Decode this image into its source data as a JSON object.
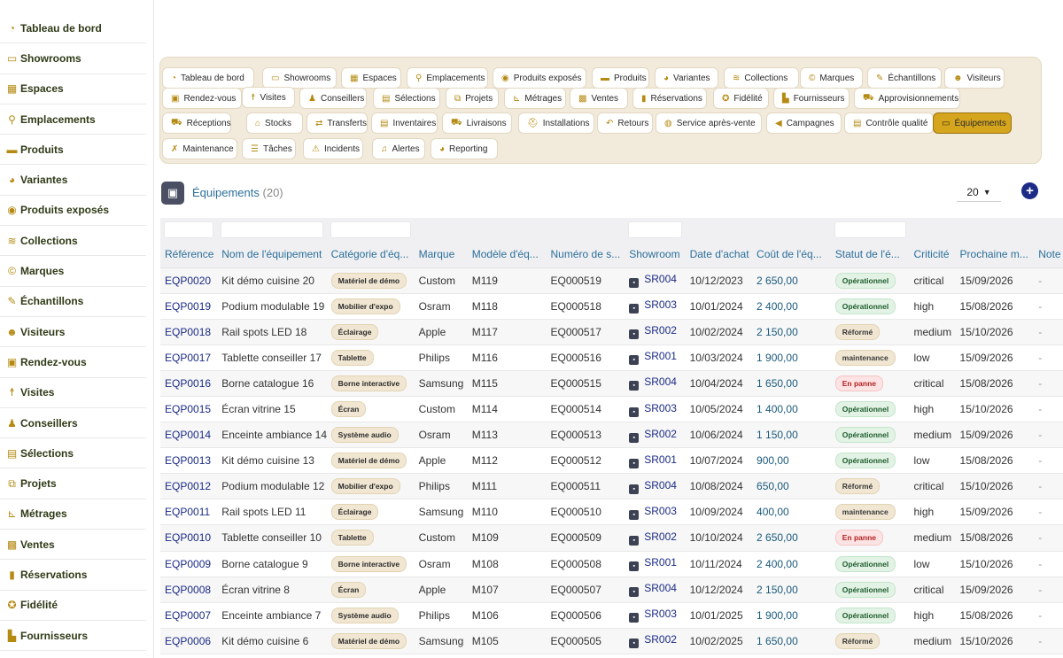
{
  "sidebar": {
    "items": [
      {
        "label": "Tableau de bord",
        "icon": "dashboard-icon",
        "glyph": "◔"
      },
      {
        "label": "Showrooms",
        "icon": "showroom-icon",
        "glyph": "▭"
      },
      {
        "label": "Espaces",
        "icon": "grid-icon",
        "glyph": "▦"
      },
      {
        "label": "Emplacements",
        "icon": "map-pin-icon",
        "glyph": "⚲"
      },
      {
        "label": "Produits",
        "icon": "box-icon",
        "glyph": "▬"
      },
      {
        "label": "Variantes",
        "icon": "palette-icon",
        "glyph": "◕"
      },
      {
        "label": "Produits exposés",
        "icon": "eye-icon",
        "glyph": "◉"
      },
      {
        "label": "Collections",
        "icon": "layers-icon",
        "glyph": "≋"
      },
      {
        "label": "Marques",
        "icon": "copyright-icon",
        "glyph": "©"
      },
      {
        "label": "Échantillons",
        "icon": "pen-icon",
        "glyph": "✎"
      },
      {
        "label": "Visiteurs",
        "icon": "users-icon",
        "glyph": "☻"
      },
      {
        "label": "Rendez-vous",
        "icon": "calendar-check-icon",
        "glyph": "▣"
      },
      {
        "label": "Visites",
        "icon": "walking-icon",
        "glyph": "☨"
      },
      {
        "label": "Conseillers",
        "icon": "user-tie-icon",
        "glyph": "♟"
      },
      {
        "label": "Sélections",
        "icon": "clipboard-icon",
        "glyph": "▤"
      },
      {
        "label": "Projets",
        "icon": "project-diagram-icon",
        "glyph": "⧉"
      },
      {
        "label": "Métrages",
        "icon": "ruler-icon",
        "glyph": "⊾"
      },
      {
        "label": "Ventes",
        "icon": "cash-register-icon",
        "glyph": "▩"
      },
      {
        "label": "Réservations",
        "icon": "bookmark-icon",
        "glyph": "▮"
      },
      {
        "label": "Fidélité",
        "icon": "award-icon",
        "glyph": "✪"
      },
      {
        "label": "Fournisseurs",
        "icon": "industry-icon",
        "glyph": "▙"
      }
    ]
  },
  "tabs": [
    {
      "label": "Tableau de bord",
      "icon": "dashboard-icon",
      "glyph": "◔"
    },
    {
      "label": "Showrooms",
      "icon": "showroom-icon",
      "glyph": "▭"
    },
    {
      "label": "Espaces",
      "icon": "grid-icon",
      "glyph": "▦"
    },
    {
      "label": "Emplacements",
      "icon": "map-pin-icon",
      "glyph": "⚲"
    },
    {
      "label": "Produits exposés",
      "icon": "eye-icon",
      "glyph": "◉"
    },
    {
      "label": "Produits",
      "icon": "box-icon",
      "glyph": "▬"
    },
    {
      "label": "Variantes",
      "icon": "palette-icon",
      "glyph": "◕"
    },
    {
      "label": "Collections",
      "icon": "layers-icon",
      "glyph": "≋"
    },
    {
      "label": "Marques",
      "icon": "copyright-icon",
      "glyph": "©"
    },
    {
      "label": "Échantillons",
      "icon": "pen-icon",
      "glyph": "✎"
    },
    {
      "label": "Visiteurs",
      "icon": "users-icon",
      "glyph": "☻"
    },
    {
      "label": "Rendez-vous",
      "icon": "calendar-check-icon",
      "glyph": "▣"
    },
    {
      "label": "Visites",
      "icon": "walking-icon",
      "glyph": "☨"
    },
    {
      "label": "Conseillers",
      "icon": "user-tie-icon",
      "glyph": "♟"
    },
    {
      "label": "Sélections",
      "icon": "clipboard-icon",
      "glyph": "▤"
    },
    {
      "label": "Projets",
      "icon": "project-diagram-icon",
      "glyph": "⧉"
    },
    {
      "label": "Métrages",
      "icon": "ruler-icon",
      "glyph": "⊾"
    },
    {
      "label": "Ventes",
      "icon": "cash-register-icon",
      "glyph": "▩"
    },
    {
      "label": "Réservations",
      "icon": "bookmark-icon",
      "glyph": "▮"
    },
    {
      "label": "Fidélité",
      "icon": "award-icon",
      "glyph": "✪"
    },
    {
      "label": "Fournisseurs",
      "icon": "industry-icon",
      "glyph": "▙"
    },
    {
      "label": "Approvisionnements",
      "icon": "dolly-icon",
      "glyph": "⛟"
    },
    {
      "label": "Réceptions",
      "icon": "truck-loading-icon",
      "glyph": "⛟"
    },
    {
      "label": "Stocks",
      "icon": "warehouse-icon",
      "glyph": "⌂"
    },
    {
      "label": "Transferts",
      "icon": "exchange-icon",
      "glyph": "⇄"
    },
    {
      "label": "Inventaires",
      "icon": "clipboard-check-icon",
      "glyph": "▤"
    },
    {
      "label": "Livraisons",
      "icon": "truck-icon",
      "glyph": "⛟"
    },
    {
      "label": "Installations",
      "icon": "hard-hat-icon",
      "glyph": "⛑"
    },
    {
      "label": "Retours",
      "icon": "undo-icon",
      "glyph": "↶"
    },
    {
      "label": "Service après-vente",
      "icon": "comment-icon",
      "glyph": "◍"
    },
    {
      "label": "Campagnes",
      "icon": "bullhorn-icon",
      "glyph": "◀"
    },
    {
      "label": "Contrôle qualité",
      "icon": "clipboard-list-icon",
      "glyph": "▤"
    },
    {
      "label": "Équipements",
      "icon": "laptop-icon",
      "glyph": "▭",
      "active": true
    },
    {
      "label": "Maintenance",
      "icon": "tools-icon",
      "glyph": "✗"
    },
    {
      "label": "Tâches",
      "icon": "tasks-icon",
      "glyph": "☰"
    },
    {
      "label": "Incidents",
      "icon": "warning-icon",
      "glyph": "⚠"
    },
    {
      "label": "Alertes",
      "icon": "bell-icon",
      "glyph": "♫"
    },
    {
      "label": "Reporting",
      "icon": "chart-pie-icon",
      "glyph": "◕"
    }
  ],
  "page": {
    "title": "Équipements",
    "count": "(20)",
    "page_size": "20",
    "add_label": "+"
  },
  "table": {
    "columns": [
      "Référence",
      "Nom de l'équipement",
      "Catégorie d'éq...",
      "Marque",
      "Modèle d'éq...",
      "Numéro de s...",
      "Showroom",
      "Date d'achat",
      "Coût de l'éq...",
      "Statut de l'é...",
      "Criticité",
      "Prochaine m...",
      "Note"
    ],
    "rows": [
      [
        "EQP0020",
        "Kit démo cuisine 20",
        "Matériel de démo",
        "Custom",
        "M119",
        "EQ000519",
        "SR004",
        "10/12/2023",
        "2 650,00",
        "Opérationnel",
        "critical",
        "15/09/2026",
        "-"
      ],
      [
        "EQP0019",
        "Podium modulable 19",
        "Mobilier d'expo",
        "Osram",
        "M118",
        "EQ000518",
        "SR003",
        "10/01/2024",
        "2 400,00",
        "Opérationnel",
        "high",
        "15/08/2026",
        "-"
      ],
      [
        "EQP0018",
        "Rail spots LED 18",
        "Éclairage",
        "Apple",
        "M117",
        "EQ000517",
        "SR002",
        "10/02/2024",
        "2 150,00",
        "Réformé",
        "medium",
        "15/10/2026",
        "-"
      ],
      [
        "EQP0017",
        "Tablette conseiller 17",
        "Tablette",
        "Philips",
        "M116",
        "EQ000516",
        "SR001",
        "10/03/2024",
        "1 900,00",
        "maintenance",
        "low",
        "15/09/2026",
        "-"
      ],
      [
        "EQP0016",
        "Borne catalogue 16",
        "Borne interactive",
        "Samsung",
        "M115",
        "EQ000515",
        "SR004",
        "10/04/2024",
        "1 650,00",
        "En panne",
        "critical",
        "15/08/2026",
        "-"
      ],
      [
        "EQP0015",
        "Écran vitrine 15",
        "Écran",
        "Custom",
        "M114",
        "EQ000514",
        "SR003",
        "10/05/2024",
        "1 400,00",
        "Opérationnel",
        "high",
        "15/10/2026",
        "-"
      ],
      [
        "EQP0014",
        "Enceinte ambiance 14",
        "Système audio",
        "Osram",
        "M113",
        "EQ000513",
        "SR002",
        "10/06/2024",
        "1 150,00",
        "Opérationnel",
        "medium",
        "15/09/2026",
        "-"
      ],
      [
        "EQP0013",
        "Kit démo cuisine 13",
        "Matériel de démo",
        "Apple",
        "M112",
        "EQ000512",
        "SR001",
        "10/07/2024",
        "900,00",
        "Opérationnel",
        "low",
        "15/08/2026",
        "-"
      ],
      [
        "EQP0012",
        "Podium modulable 12",
        "Mobilier d'expo",
        "Philips",
        "M111",
        "EQ000511",
        "SR004",
        "10/08/2024",
        "650,00",
        "Réformé",
        "critical",
        "15/10/2026",
        "-"
      ],
      [
        "EQP0011",
        "Rail spots LED 11",
        "Éclairage",
        "Samsung",
        "M110",
        "EQ000510",
        "SR003",
        "10/09/2024",
        "400,00",
        "maintenance",
        "high",
        "15/09/2026",
        "-"
      ],
      [
        "EQP0010",
        "Tablette conseiller 10",
        "Tablette",
        "Custom",
        "M109",
        "EQ000509",
        "SR002",
        "10/10/2024",
        "2 650,00",
        "En panne",
        "medium",
        "15/08/2026",
        "-"
      ],
      [
        "EQP0009",
        "Borne catalogue 9",
        "Borne interactive",
        "Osram",
        "M108",
        "EQ000508",
        "SR001",
        "10/11/2024",
        "2 400,00",
        "Opérationnel",
        "low",
        "15/10/2026",
        "-"
      ],
      [
        "EQP0008",
        "Écran vitrine 8",
        "Écran",
        "Apple",
        "M107",
        "EQ000507",
        "SR004",
        "10/12/2024",
        "2 150,00",
        "Opérationnel",
        "critical",
        "15/09/2026",
        "-"
      ],
      [
        "EQP0007",
        "Enceinte ambiance 7",
        "Système audio",
        "Philips",
        "M106",
        "EQ000506",
        "SR003",
        "10/01/2025",
        "1 900,00",
        "Opérationnel",
        "high",
        "15/08/2026",
        "-"
      ],
      [
        "EQP0006",
        "Kit démo cuisine 6",
        "Matériel de démo",
        "Samsung",
        "M105",
        "EQ000505",
        "SR002",
        "10/02/2025",
        "1 650,00",
        "Réformé",
        "medium",
        "15/10/2026",
        "-"
      ]
    ]
  },
  "colors": {
    "accent": "#d6a51e",
    "link": "#1b2b86",
    "header_text": "#2b6f9a",
    "tab_panel": "#f2eadb",
    "status_ok": "#1e5b2c",
    "status_down": "#b32121"
  }
}
